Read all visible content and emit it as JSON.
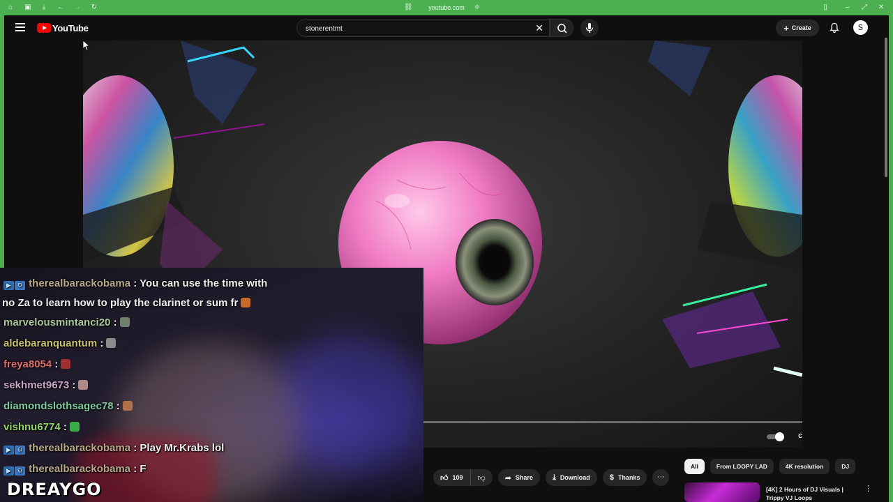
{
  "browser": {
    "url": "youtube.com"
  },
  "masthead": {
    "logo_text": "YouTube",
    "search_value": "stonerentmt",
    "create_label": "Create",
    "avatar_letter": "S"
  },
  "video": {
    "progress_fraction": 0.01
  },
  "actions": {
    "like_count": "109",
    "share_label": "Share",
    "download_label": "Download",
    "thanks_label": "Thanks",
    "more_label": "···"
  },
  "chips": [
    "All",
    "From LOOPY LAD",
    "4K resolution",
    "DJ"
  ],
  "recommendation": {
    "title": "[4K] 2 Hours of DJ Visuals | Trippy VJ Loops"
  },
  "overlay": {
    "watermark": "DREAYGO",
    "chat": [
      {
        "user": "therealbarackobama",
        "badge": true,
        "color": "#b8a98a",
        "text": ": You can use the time with",
        "emote_color": ""
      },
      {
        "wrap": "no Za to learn how to play the clarinet or sum fr",
        "emote_color": "#c96a2d"
      },
      {
        "user": "marvelousmintanci20",
        "badge": false,
        "color": "#a9c99e",
        "text": ":",
        "emote_color": "#6e7f6e"
      },
      {
        "user": "aldebaranquantum",
        "badge": false,
        "color": "#c9c06e",
        "text": ":",
        "emote_color": "#8c8c8c"
      },
      {
        "user": "freya8054",
        "badge": false,
        "color": "#e06b6b",
        "text": ":",
        "emote_color": "#a03030"
      },
      {
        "user": "sekhmet9673",
        "badge": false,
        "color": "#c8a6c8",
        "text": ":",
        "emote_color": "#b08a8a"
      },
      {
        "user": "diamondslothsagec78",
        "badge": false,
        "color": "#7ec8a0",
        "text": ":",
        "emote_color": "#b0704a"
      },
      {
        "user": "vishnu6774",
        "badge": false,
        "color": "#8fd66a",
        "text": ":",
        "emote_color": "#3aa94a"
      },
      {
        "user": "therealbarackobama",
        "badge": true,
        "color": "#b8a98a",
        "text": ": Play Mr.Krabs lol",
        "emote_color": ""
      },
      {
        "user": "therealbarackobama",
        "badge": true,
        "color": "#b8a98a",
        "text": ": F",
        "emote_color": ""
      }
    ]
  }
}
